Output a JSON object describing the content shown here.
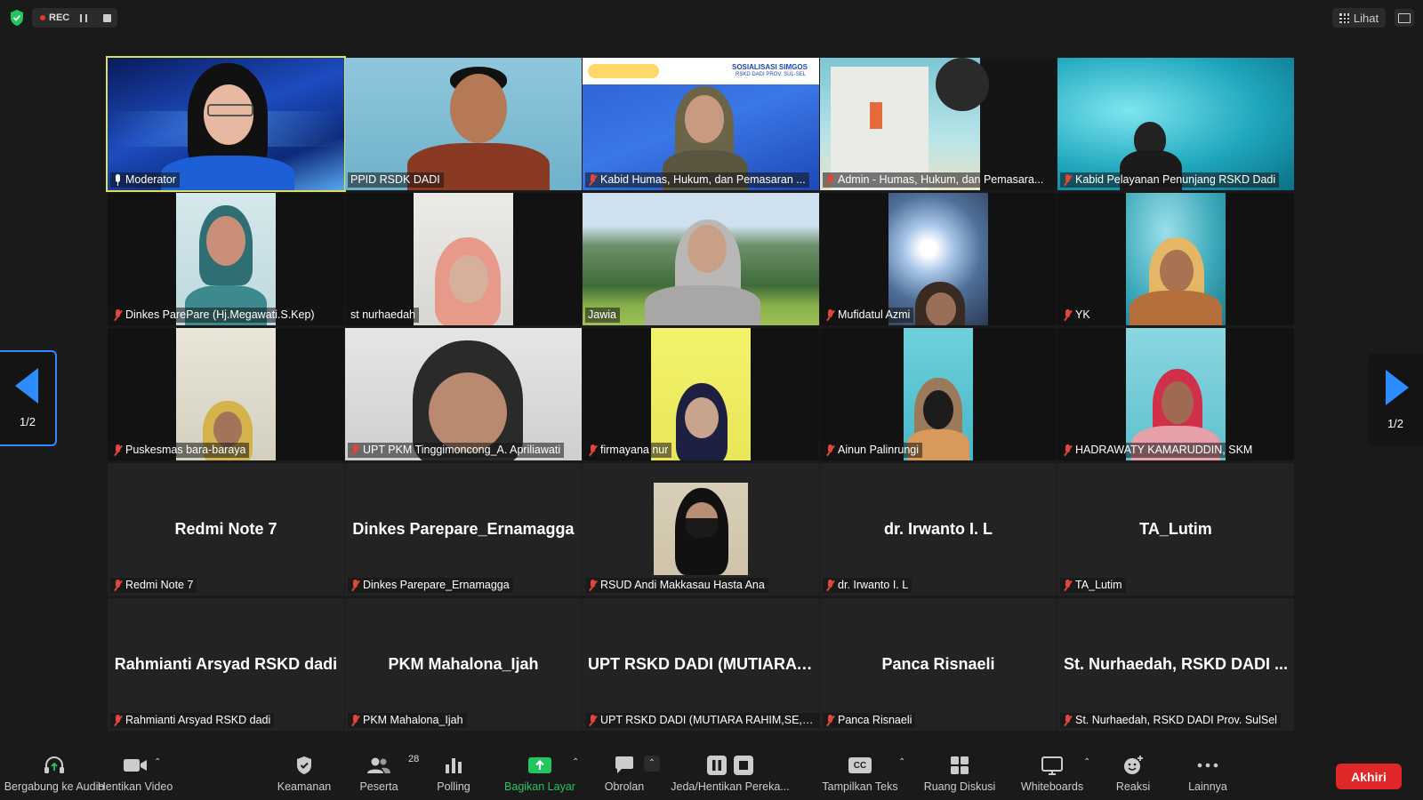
{
  "topbar": {
    "rec_label": "REC",
    "view_label": "Lihat"
  },
  "navigation": {
    "page_left": "1/2",
    "page_right": "1/2"
  },
  "tiles": [
    {
      "label": "Moderator",
      "big": ""
    },
    {
      "label": "PPID RSDK DADI",
      "big": ""
    },
    {
      "label": "Kabid Humas, Hukum, dan Pemasaran ...",
      "big": "",
      "slide_title": "SOSIALISASI SIMGOS",
      "slide_sub": "RSKD DADI PROV. SUL-SEL"
    },
    {
      "label": "Admin - Humas, Hukum, dan Pemasara...",
      "big": ""
    },
    {
      "label": "Kabid Pelayanan Penunjang RSKD Dadi",
      "big": ""
    },
    {
      "label": "Dinkes ParePare (Hj.Megawati.S.Kep)",
      "big": ""
    },
    {
      "label": "st nurhaedah",
      "big": ""
    },
    {
      "label": "Jawia",
      "big": ""
    },
    {
      "label": "Mufidatul Azmi",
      "big": ""
    },
    {
      "label": "YK",
      "big": ""
    },
    {
      "label": "Puskesmas bara-baraya",
      "big": ""
    },
    {
      "label": "UPT PKM Tinggimoncong_A. Apriliawati",
      "big": ""
    },
    {
      "label": "firmayana nur",
      "big": ""
    },
    {
      "label": "Ainun Palinrungi",
      "big": ""
    },
    {
      "label": "HADRAWATY KAMARUDDIN, SKM",
      "big": ""
    },
    {
      "label": "Redmi Note 7",
      "big": "Redmi Note 7"
    },
    {
      "label": "Dinkes Parepare_Ernamagga",
      "big": "Dinkes Parepare_Ernamagga"
    },
    {
      "label": "RSUD Andi Makkasau Hasta Ana",
      "big": ""
    },
    {
      "label": "dr. Irwanto I. L",
      "big": "dr. Irwanto I. L"
    },
    {
      "label": "TA_Lutim",
      "big": "TA_Lutim"
    },
    {
      "label": "Rahmianti Arsyad RSKD dadi",
      "big": "Rahmianti Arsyad RSKD dadi"
    },
    {
      "label": "PKM Mahalona_Ijah",
      "big": "PKM Mahalona_Ijah"
    },
    {
      "label": "UPT RSKD DADI (MUTIARA RAHIM,SE,M...",
      "big": "UPT RSKD DADI (MUTIARA ..."
    },
    {
      "label": "Panca Risnaeli",
      "big": "Panca Risnaeli"
    },
    {
      "label": "St. Nurhaedah, RSKD DADI Prov. SulSel",
      "big": "St. Nurhaedah, RSKD DADI ..."
    }
  ],
  "toolbar": {
    "join_audio": "Bergabung ke Audio",
    "stop_video": "Hentikan Video",
    "security": "Keamanan",
    "participants": "Peserta",
    "participants_count": "28",
    "polling": "Polling",
    "share_screen": "Bagikan Layar",
    "chat": "Obrolan",
    "pause_recording": "Jeda/Hentikan Pereka...",
    "captions": "Tampilkan Teks",
    "captions_icon_text": "CC",
    "breakout": "Ruang Diskusi",
    "whiteboards": "Whiteboards",
    "reactions": "Reaksi",
    "more": "Lainnya",
    "end": "Akhiri"
  },
  "colors": {
    "accent_blue": "#2d8cff",
    "active_speaker": "#d8e05a",
    "end_red": "#e02828",
    "share_green": "#22c55e",
    "mic_muted": "#e0463b"
  }
}
